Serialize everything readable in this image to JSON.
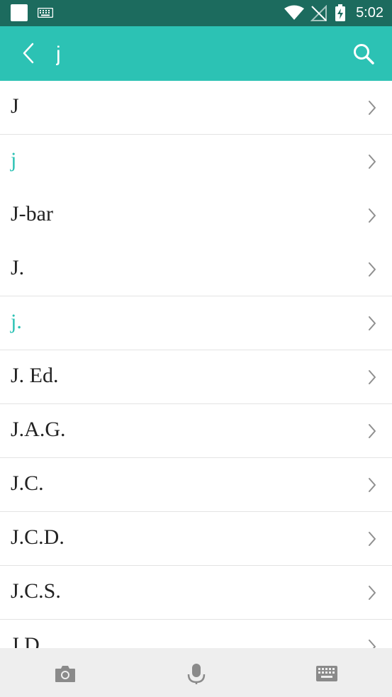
{
  "status_bar": {
    "time": "5:02",
    "icons": [
      "notification-square-icon",
      "keyboard-icon",
      "wifi-icon",
      "no-signal-icon",
      "battery-charging-icon"
    ]
  },
  "search": {
    "query": "j",
    "back_icon": "chevron-left-icon",
    "search_icon": "search-icon"
  },
  "results": [
    {
      "label": "J",
      "highlight": false
    },
    {
      "label": "j",
      "highlight": true
    },
    {
      "label": "J-bar",
      "highlight": false
    },
    {
      "label": "J.",
      "highlight": false
    },
    {
      "label": "j.",
      "highlight": true
    },
    {
      "label": "J. Ed.",
      "highlight": false
    },
    {
      "label": "J.A.G.",
      "highlight": false
    },
    {
      "label": "J.C.",
      "highlight": false
    },
    {
      "label": "J.C.D.",
      "highlight": false
    },
    {
      "label": "J.C.S.",
      "highlight": false
    },
    {
      "label": "J.D.",
      "highlight": false
    }
  ],
  "bottom_bar": {
    "icons": [
      "camera-icon",
      "microphone-icon",
      "keyboard-icon"
    ]
  },
  "colors": {
    "status_bar": "#1c6b5e",
    "toolbar": "#2cc2b4",
    "highlight": "#2cc2b4",
    "bottom_bar": "#eeeeee"
  }
}
